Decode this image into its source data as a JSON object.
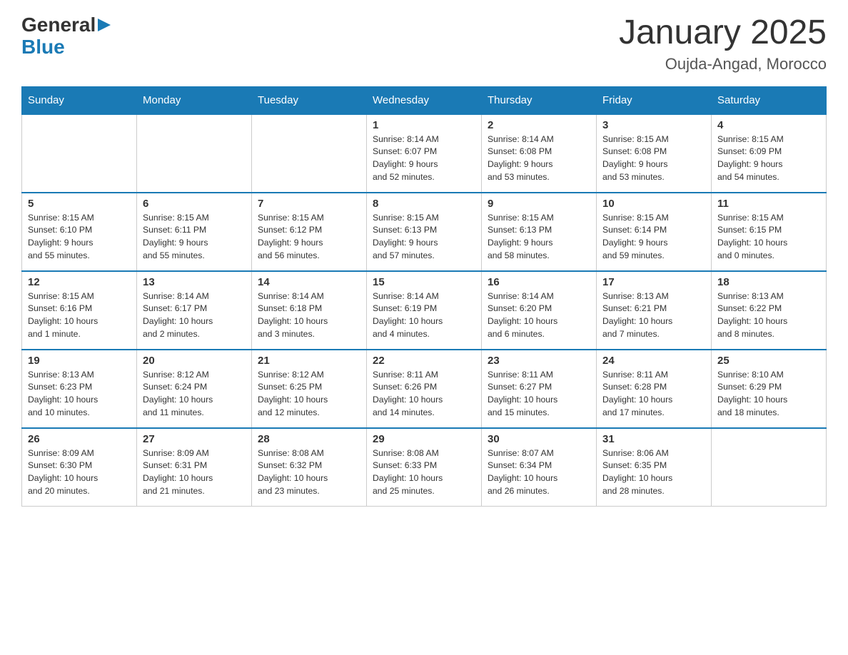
{
  "header": {
    "logo_general": "General",
    "logo_blue": "Blue",
    "month_title": "January 2025",
    "location": "Oujda-Angad, Morocco"
  },
  "days_of_week": [
    "Sunday",
    "Monday",
    "Tuesday",
    "Wednesday",
    "Thursday",
    "Friday",
    "Saturday"
  ],
  "weeks": [
    [
      {
        "day": "",
        "info": ""
      },
      {
        "day": "",
        "info": ""
      },
      {
        "day": "",
        "info": ""
      },
      {
        "day": "1",
        "info": "Sunrise: 8:14 AM\nSunset: 6:07 PM\nDaylight: 9 hours\nand 52 minutes."
      },
      {
        "day": "2",
        "info": "Sunrise: 8:14 AM\nSunset: 6:08 PM\nDaylight: 9 hours\nand 53 minutes."
      },
      {
        "day": "3",
        "info": "Sunrise: 8:15 AM\nSunset: 6:08 PM\nDaylight: 9 hours\nand 53 minutes."
      },
      {
        "day": "4",
        "info": "Sunrise: 8:15 AM\nSunset: 6:09 PM\nDaylight: 9 hours\nand 54 minutes."
      }
    ],
    [
      {
        "day": "5",
        "info": "Sunrise: 8:15 AM\nSunset: 6:10 PM\nDaylight: 9 hours\nand 55 minutes."
      },
      {
        "day": "6",
        "info": "Sunrise: 8:15 AM\nSunset: 6:11 PM\nDaylight: 9 hours\nand 55 minutes."
      },
      {
        "day": "7",
        "info": "Sunrise: 8:15 AM\nSunset: 6:12 PM\nDaylight: 9 hours\nand 56 minutes."
      },
      {
        "day": "8",
        "info": "Sunrise: 8:15 AM\nSunset: 6:13 PM\nDaylight: 9 hours\nand 57 minutes."
      },
      {
        "day": "9",
        "info": "Sunrise: 8:15 AM\nSunset: 6:13 PM\nDaylight: 9 hours\nand 58 minutes."
      },
      {
        "day": "10",
        "info": "Sunrise: 8:15 AM\nSunset: 6:14 PM\nDaylight: 9 hours\nand 59 minutes."
      },
      {
        "day": "11",
        "info": "Sunrise: 8:15 AM\nSunset: 6:15 PM\nDaylight: 10 hours\nand 0 minutes."
      }
    ],
    [
      {
        "day": "12",
        "info": "Sunrise: 8:15 AM\nSunset: 6:16 PM\nDaylight: 10 hours\nand 1 minute."
      },
      {
        "day": "13",
        "info": "Sunrise: 8:14 AM\nSunset: 6:17 PM\nDaylight: 10 hours\nand 2 minutes."
      },
      {
        "day": "14",
        "info": "Sunrise: 8:14 AM\nSunset: 6:18 PM\nDaylight: 10 hours\nand 3 minutes."
      },
      {
        "day": "15",
        "info": "Sunrise: 8:14 AM\nSunset: 6:19 PM\nDaylight: 10 hours\nand 4 minutes."
      },
      {
        "day": "16",
        "info": "Sunrise: 8:14 AM\nSunset: 6:20 PM\nDaylight: 10 hours\nand 6 minutes."
      },
      {
        "day": "17",
        "info": "Sunrise: 8:13 AM\nSunset: 6:21 PM\nDaylight: 10 hours\nand 7 minutes."
      },
      {
        "day": "18",
        "info": "Sunrise: 8:13 AM\nSunset: 6:22 PM\nDaylight: 10 hours\nand 8 minutes."
      }
    ],
    [
      {
        "day": "19",
        "info": "Sunrise: 8:13 AM\nSunset: 6:23 PM\nDaylight: 10 hours\nand 10 minutes."
      },
      {
        "day": "20",
        "info": "Sunrise: 8:12 AM\nSunset: 6:24 PM\nDaylight: 10 hours\nand 11 minutes."
      },
      {
        "day": "21",
        "info": "Sunrise: 8:12 AM\nSunset: 6:25 PM\nDaylight: 10 hours\nand 12 minutes."
      },
      {
        "day": "22",
        "info": "Sunrise: 8:11 AM\nSunset: 6:26 PM\nDaylight: 10 hours\nand 14 minutes."
      },
      {
        "day": "23",
        "info": "Sunrise: 8:11 AM\nSunset: 6:27 PM\nDaylight: 10 hours\nand 15 minutes."
      },
      {
        "day": "24",
        "info": "Sunrise: 8:11 AM\nSunset: 6:28 PM\nDaylight: 10 hours\nand 17 minutes."
      },
      {
        "day": "25",
        "info": "Sunrise: 8:10 AM\nSunset: 6:29 PM\nDaylight: 10 hours\nand 18 minutes."
      }
    ],
    [
      {
        "day": "26",
        "info": "Sunrise: 8:09 AM\nSunset: 6:30 PM\nDaylight: 10 hours\nand 20 minutes."
      },
      {
        "day": "27",
        "info": "Sunrise: 8:09 AM\nSunset: 6:31 PM\nDaylight: 10 hours\nand 21 minutes."
      },
      {
        "day": "28",
        "info": "Sunrise: 8:08 AM\nSunset: 6:32 PM\nDaylight: 10 hours\nand 23 minutes."
      },
      {
        "day": "29",
        "info": "Sunrise: 8:08 AM\nSunset: 6:33 PM\nDaylight: 10 hours\nand 25 minutes."
      },
      {
        "day": "30",
        "info": "Sunrise: 8:07 AM\nSunset: 6:34 PM\nDaylight: 10 hours\nand 26 minutes."
      },
      {
        "day": "31",
        "info": "Sunrise: 8:06 AM\nSunset: 6:35 PM\nDaylight: 10 hours\nand 28 minutes."
      },
      {
        "day": "",
        "info": ""
      }
    ]
  ]
}
